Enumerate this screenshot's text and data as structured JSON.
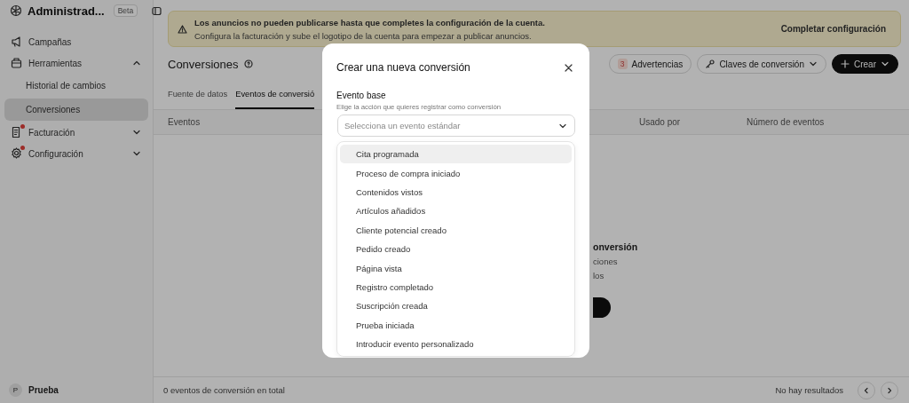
{
  "sidebar": {
    "title": "Administrad...",
    "badge": "Beta",
    "items": [
      {
        "label": "Campañas",
        "notification": false,
        "selected": false
      },
      {
        "label": "Herramientas",
        "notification": false,
        "selected": false,
        "expanded": true,
        "children": [
          {
            "label": "Historial de cambios",
            "selected": false
          },
          {
            "label": "Conversiones",
            "selected": true
          }
        ]
      },
      {
        "label": "Facturación",
        "notification": true,
        "selected": false,
        "expanded": false
      },
      {
        "label": "Configuración",
        "notification": true,
        "selected": false,
        "expanded": false
      }
    ],
    "user": {
      "initial": "P",
      "name": "Prueba"
    }
  },
  "banner": {
    "title": "Los anuncios no pueden publicarse hasta que completes la configuración de la cuenta.",
    "text": "Configura la facturación y sube el logotipo de la cuenta para empezar a publicar anuncios.",
    "action": "Completar configuración"
  },
  "page": {
    "title": "Conversiones",
    "warnings": {
      "count": "3",
      "label": "Advertencias"
    },
    "keys_button": "Claves de conversión",
    "create_button": "Crear"
  },
  "tabs": [
    {
      "label": "Fuente de datos",
      "selected": false
    },
    {
      "label": "Eventos de conversió",
      "selected": true
    }
  ],
  "table": {
    "columns": [
      "Eventos",
      "Usado por",
      "Número de eventos"
    ]
  },
  "empty_state": {
    "title": "onversión",
    "lines": [
      "ciones",
      "los"
    ]
  },
  "footer": {
    "total": "0 eventos de conversión en total",
    "results": "No hay resultados"
  },
  "dialog": {
    "title": "Crear una nueva conversión",
    "field_label": "Evento base",
    "field_hint": "Elige la acción que quieres registrar como conversión",
    "placeholder": "Selecciona un evento estándar",
    "options": [
      {
        "label": "Cita programada",
        "selected": true
      },
      {
        "label": "Proceso de compra iniciado",
        "selected": false
      },
      {
        "label": "Contenidos vistos",
        "selected": false
      },
      {
        "label": "Artículos añadidos",
        "selected": false
      },
      {
        "label": "Cliente potencial creado",
        "selected": false
      },
      {
        "label": "Pedido creado",
        "selected": false
      },
      {
        "label": "Página vista",
        "selected": false
      },
      {
        "label": "Registro completado",
        "selected": false
      },
      {
        "label": "Suscripción creada",
        "selected": false
      },
      {
        "label": "Prueba iniciada",
        "selected": false
      },
      {
        "label": "Introducir evento personalizado",
        "selected": false
      }
    ]
  }
}
